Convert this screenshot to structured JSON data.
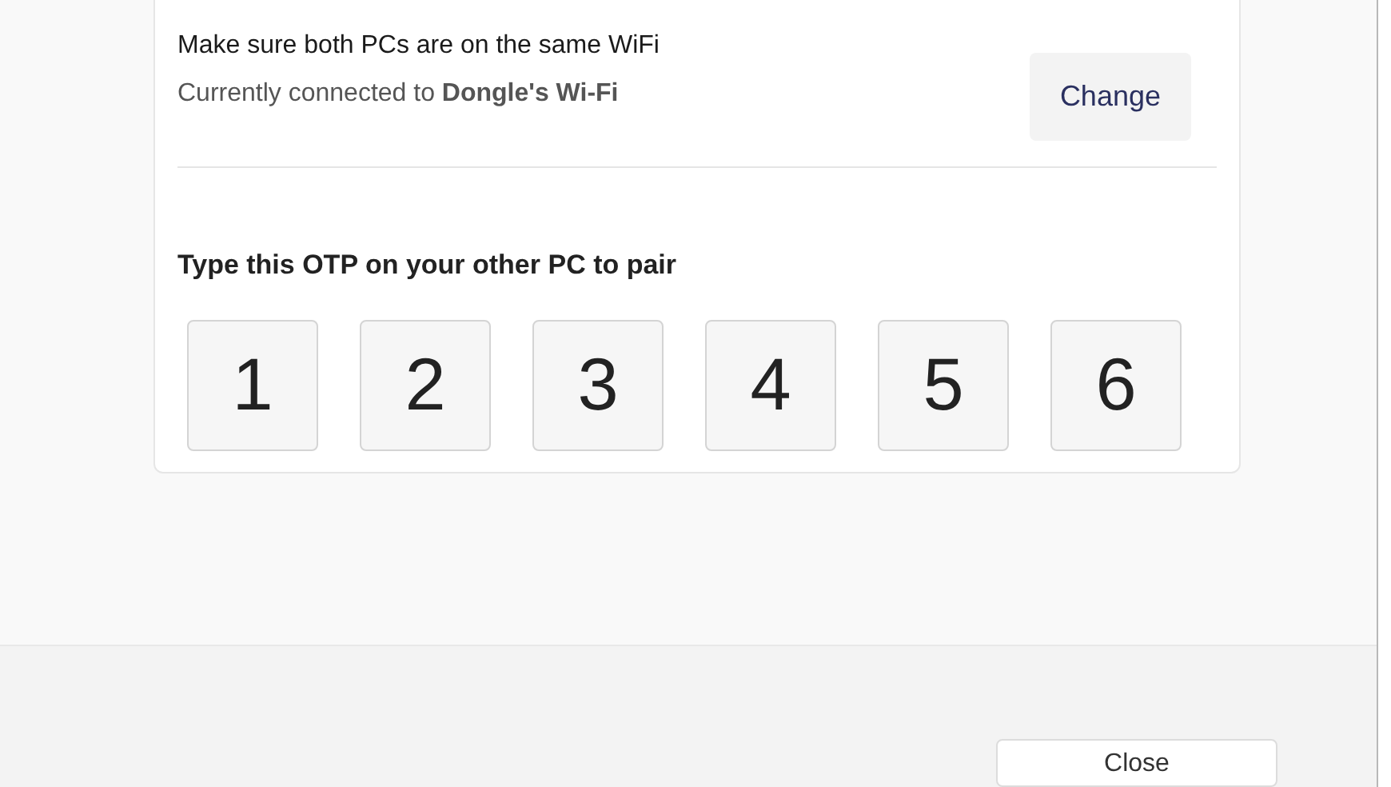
{
  "wifi": {
    "title": "Make sure both PCs are on the same WiFi",
    "status": "Currently connected to **Dongle's Wi-Fi**",
    "button": "Change"
  },
  "otp": {
    "title": "Type this OTP on your other PC to pair",
    "digits": [
      "1",
      "2",
      "3",
      "4",
      "5",
      "6"
    ]
  },
  "footer": {
    "button": "Close"
  }
}
